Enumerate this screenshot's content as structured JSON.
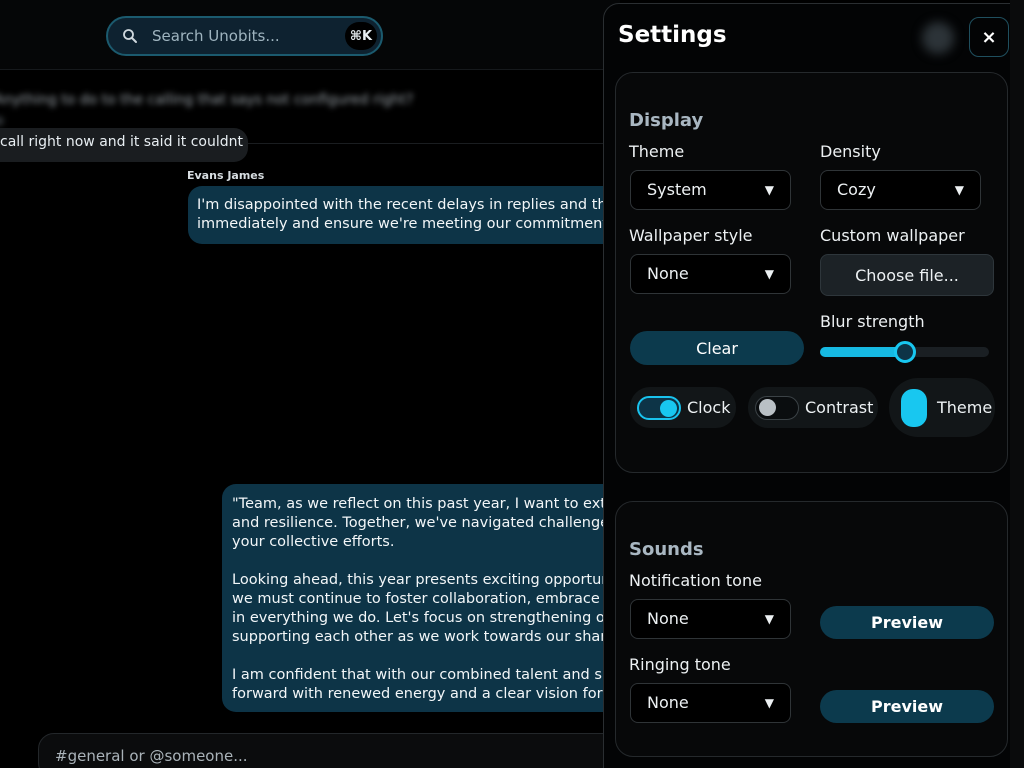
{
  "search": {
    "placeholder": "Search Unobits...",
    "shortcut": "⌘K"
  },
  "chat": {
    "blurred_line": "Anything to do to the calling that says not configured right?",
    "previous_message": "call right now and it said it couldnt",
    "messages": [
      {
        "sender": "Evans James",
        "lines": [
          "I'm disappointed with the recent delays in replies and the c",
          "immediately and ensure we're meeting our commitments."
        ]
      },
      {
        "sender": "",
        "paragraphs": [
          [
            "\"Team, as we reflect on this past year, I want to extend",
            "and resilience. Together, we've navigated challenges an",
            "your collective efforts."
          ],
          [
            "Looking ahead, this year presents exciting opportuniti",
            "we must continue to foster collaboration, embrace ne",
            "in everything we do. Let's focus on strengthening our",
            "supporting each other as we work towards our shared"
          ],
          [
            "I am confident that with our combined talent and spir",
            "forward with renewed energy and a clear vision for su"
          ]
        ]
      }
    ],
    "composer_placeholder": "#general or @someone..."
  },
  "settings": {
    "title": "Settings",
    "close_label": "×",
    "display": {
      "title": "Display",
      "theme": {
        "label": "Theme",
        "value": "System"
      },
      "density": {
        "label": "Density",
        "value": "Cozy"
      },
      "wallpaper_style": {
        "label": "Wallpaper style",
        "value": "None"
      },
      "custom_wallpaper": {
        "label": "Custom wallpaper",
        "button": "Choose file..."
      },
      "clear_button": "Clear",
      "blur_strength": {
        "label": "Blur strength",
        "value": 0.5
      },
      "toggles": {
        "clock": {
          "label": "Clock",
          "on": true
        },
        "contrast": {
          "label": "Contrast",
          "on": false
        },
        "theme": {
          "label": "Theme"
        }
      }
    },
    "sounds": {
      "title": "Sounds",
      "notification_tone": {
        "label": "Notification tone",
        "value": "None",
        "preview": "Preview"
      },
      "ringing_tone": {
        "label": "Ringing tone",
        "value": "None",
        "preview": "Preview"
      }
    }
  },
  "colors": {
    "accent": "#18c7f0",
    "bubble": "#0d3447",
    "button_teal": "#0c3a4d",
    "background": "#000000"
  },
  "icons": {
    "search": "search-icon",
    "caret": "chevron-down-icon",
    "close": "close-icon"
  }
}
